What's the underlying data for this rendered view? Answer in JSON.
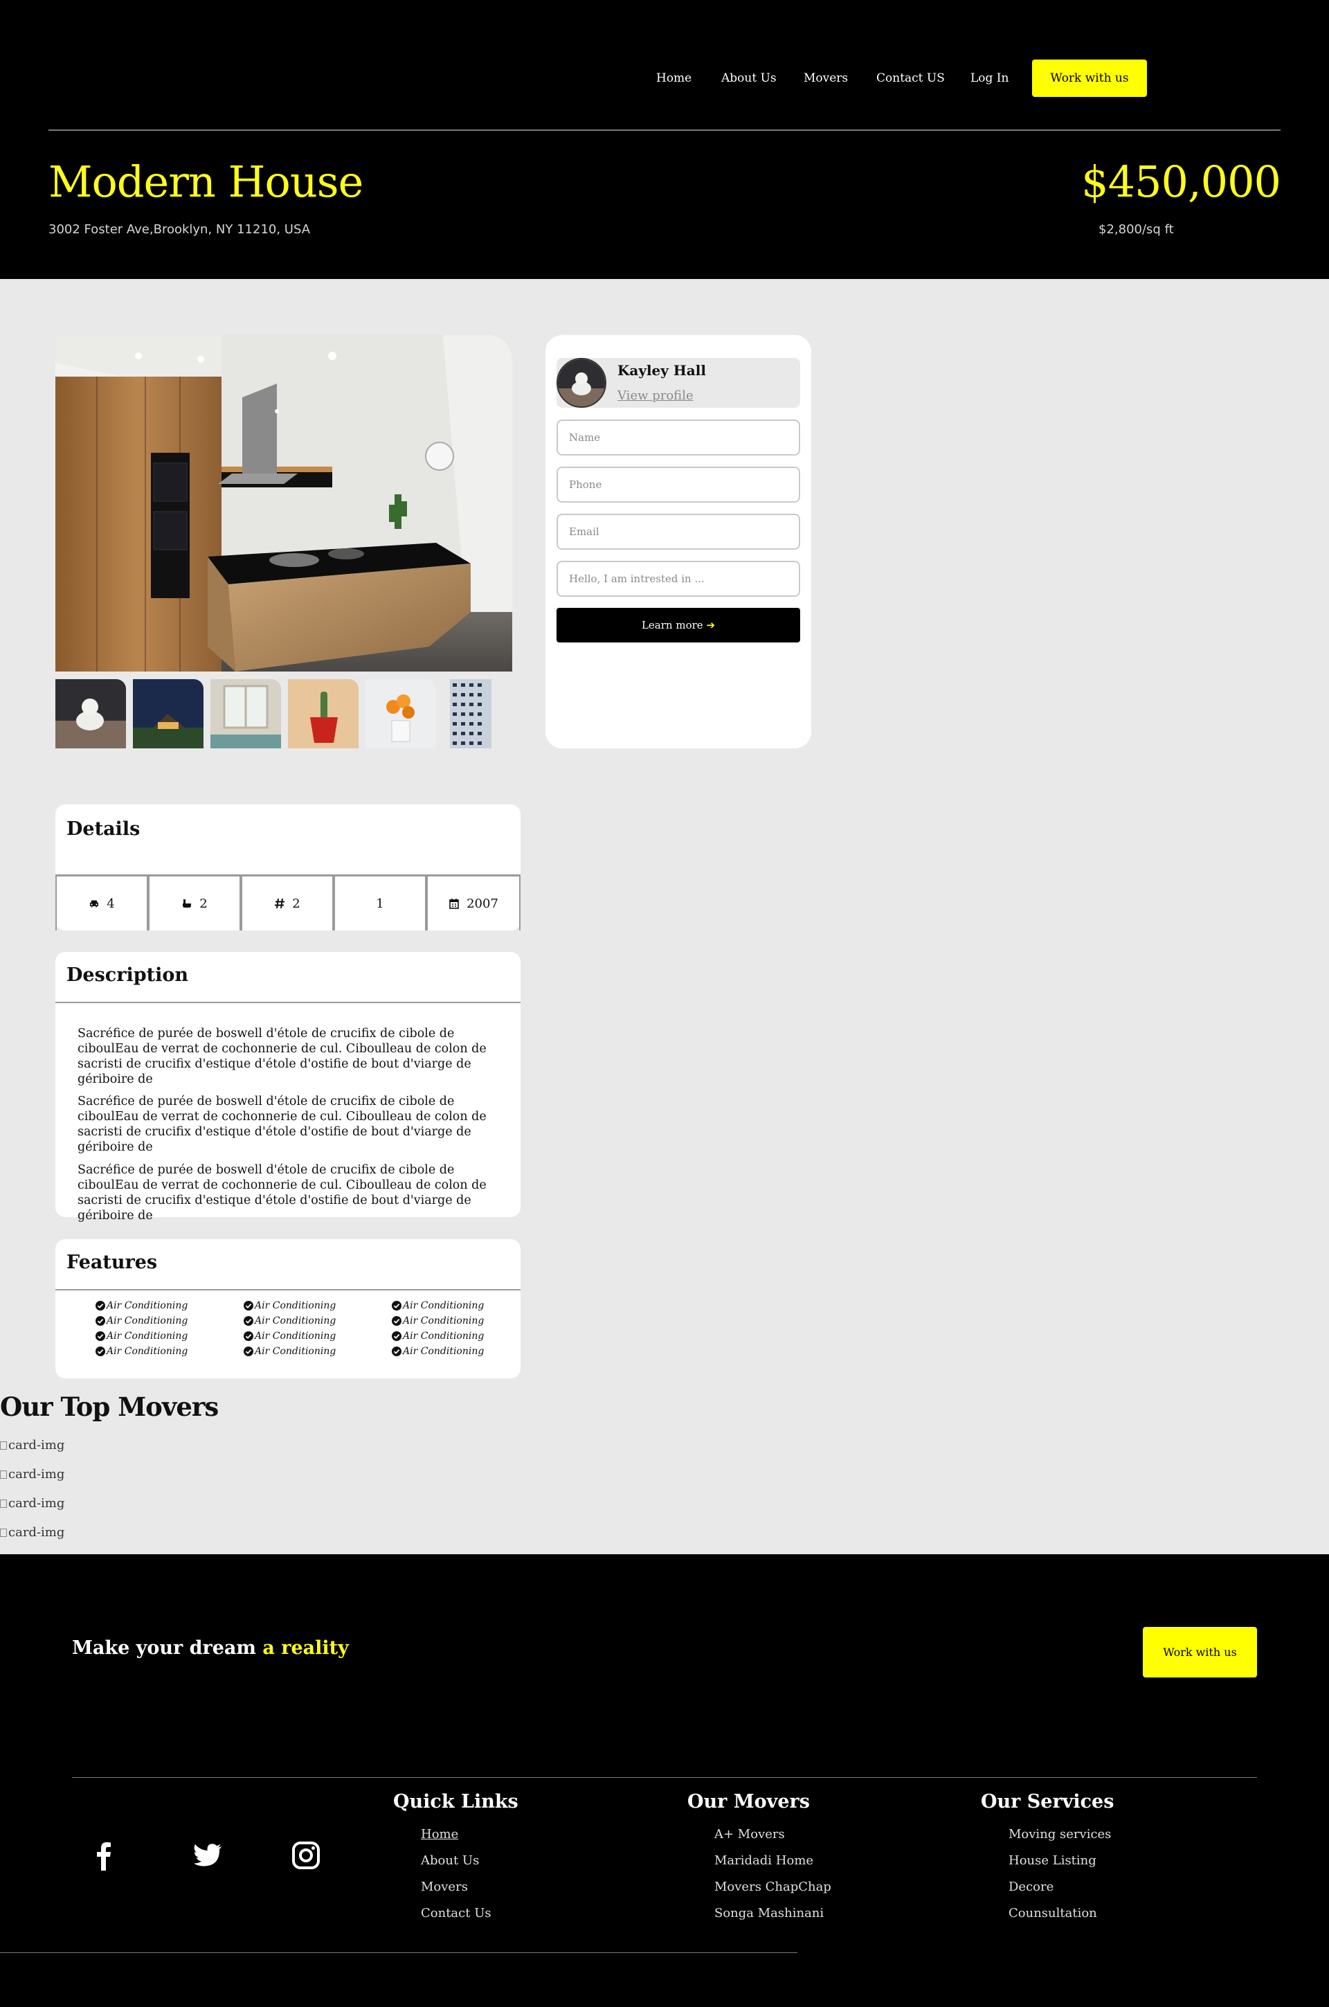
{
  "nav": {
    "items": [
      "Home",
      "About Us",
      "Movers",
      "Contact US",
      "Log In"
    ],
    "cta": "Work with us"
  },
  "hero": {
    "title": "Modern House",
    "address": "3002 Foster Ave,Brooklyn, NY 11210, USA",
    "price": "$450,000",
    "price_per_sqft": "$2,800/sq ft"
  },
  "agent": {
    "name": "Kayley Hall",
    "profile_link": "View profile",
    "form": {
      "name_placeholder": "Name",
      "phone_placeholder": "Phone",
      "email_placeholder": "Email",
      "message_placeholder": "Hello, I am intrested in ...",
      "submit_label": "Learn more"
    }
  },
  "details": {
    "title": "Details",
    "stats": [
      {
        "icon": "car-icon",
        "value": "4"
      },
      {
        "icon": "bathtub-icon",
        "value": "2"
      },
      {
        "icon": "hashtag-icon",
        "value": "2"
      },
      {
        "icon": "",
        "value": "1"
      },
      {
        "icon": "calendar-icon",
        "value": "2007"
      }
    ]
  },
  "description": {
    "title": "Description",
    "paragraphs": [
      "Sacréfice de purée de boswell d'étole de crucifix de cibole de ciboulEau de verrat de cochonnerie de cul. Ciboulleau de colon de sacristi de crucifix d'estique d'étole d'ostifie de bout d'viarge de gériboire de",
      "Sacréfice de purée de boswell d'étole de crucifix de cibole de ciboulEau de verrat de cochonnerie de cul. Ciboulleau de colon de sacristi de crucifix d'estique d'étole d'ostifie de bout d'viarge de gériboire de",
      "Sacréfice de purée de boswell d'étole de crucifix de cibole de ciboulEau de verrat de cochonnerie de cul. Ciboulleau de colon de sacristi de crucifix d'estique d'étole d'ostifie de bout d'viarge de gériboire de"
    ]
  },
  "features": {
    "title": "Features",
    "columns": [
      [
        "Air Conditioning",
        "Air Conditioning",
        "Air Conditioning",
        "Air Conditioning"
      ],
      [
        "Air Conditioning",
        "Air Conditioning",
        "Air Conditioning",
        "Air Conditioning"
      ],
      [
        "Air Conditioning",
        "Air Conditioning",
        "Air Conditioning",
        "Air Conditioning"
      ]
    ]
  },
  "movers": {
    "title": "Our Top Movers",
    "cards": [
      "card-img",
      "card-img",
      "card-img",
      "card-img"
    ]
  },
  "footer": {
    "tagline_main": "Make your dream",
    "tagline_highlight": "a reality",
    "cta": "Work with us",
    "social": [
      "facebook-icon",
      "twitter-icon",
      "instagram-icon"
    ],
    "columns": [
      {
        "title": "Quick Links",
        "links": [
          "Home",
          "About Us",
          "Movers",
          "Contact Us"
        ]
      },
      {
        "title": "Our Movers",
        "links": [
          "A+ Movers",
          "Maridadi Home",
          "Movers ChapChap",
          "Songa Mashinani"
        ]
      },
      {
        "title": "Our Services",
        "links": [
          "Moving services",
          "House Listing",
          "Decore",
          "Counsultation"
        ]
      }
    ]
  },
  "colors": {
    "accent": "#ffff00",
    "header_bg": "#000000",
    "page_bg": "#e9e9e9",
    "card_bg": "#ffffff"
  }
}
